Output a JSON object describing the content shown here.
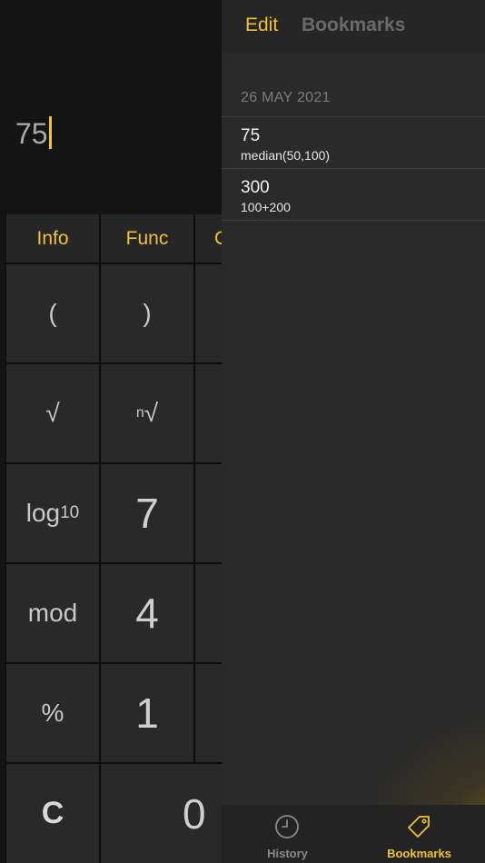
{
  "display": {
    "value": "75"
  },
  "keypad": {
    "top_row": [
      "Info",
      "Func",
      "C"
    ],
    "keys": {
      "paren_open": "(",
      "paren_close": ")",
      "sqrt": "√",
      "nth_root_index": "n",
      "nth_root": "√",
      "log_main": "log",
      "log_base": "10",
      "seven": "7",
      "mod": "mod",
      "four": "4",
      "percent": "%",
      "one": "1",
      "clear": "C",
      "zero": "0"
    }
  },
  "panel": {
    "edit_label": "Edit",
    "title": "Bookmarks",
    "date_header": "26 MAY 2021",
    "entries": [
      {
        "result": "75",
        "expression": "median(50,100)"
      },
      {
        "result": "300",
        "expression": "100+200"
      }
    ]
  },
  "tabbar": {
    "history_label": "History",
    "bookmarks_label": "Bookmarks",
    "history_icon": "clock-icon",
    "bookmarks_icon": "tag-icon"
  },
  "colors": {
    "accent": "#f2c230",
    "inactive": "#8a8a8a"
  }
}
